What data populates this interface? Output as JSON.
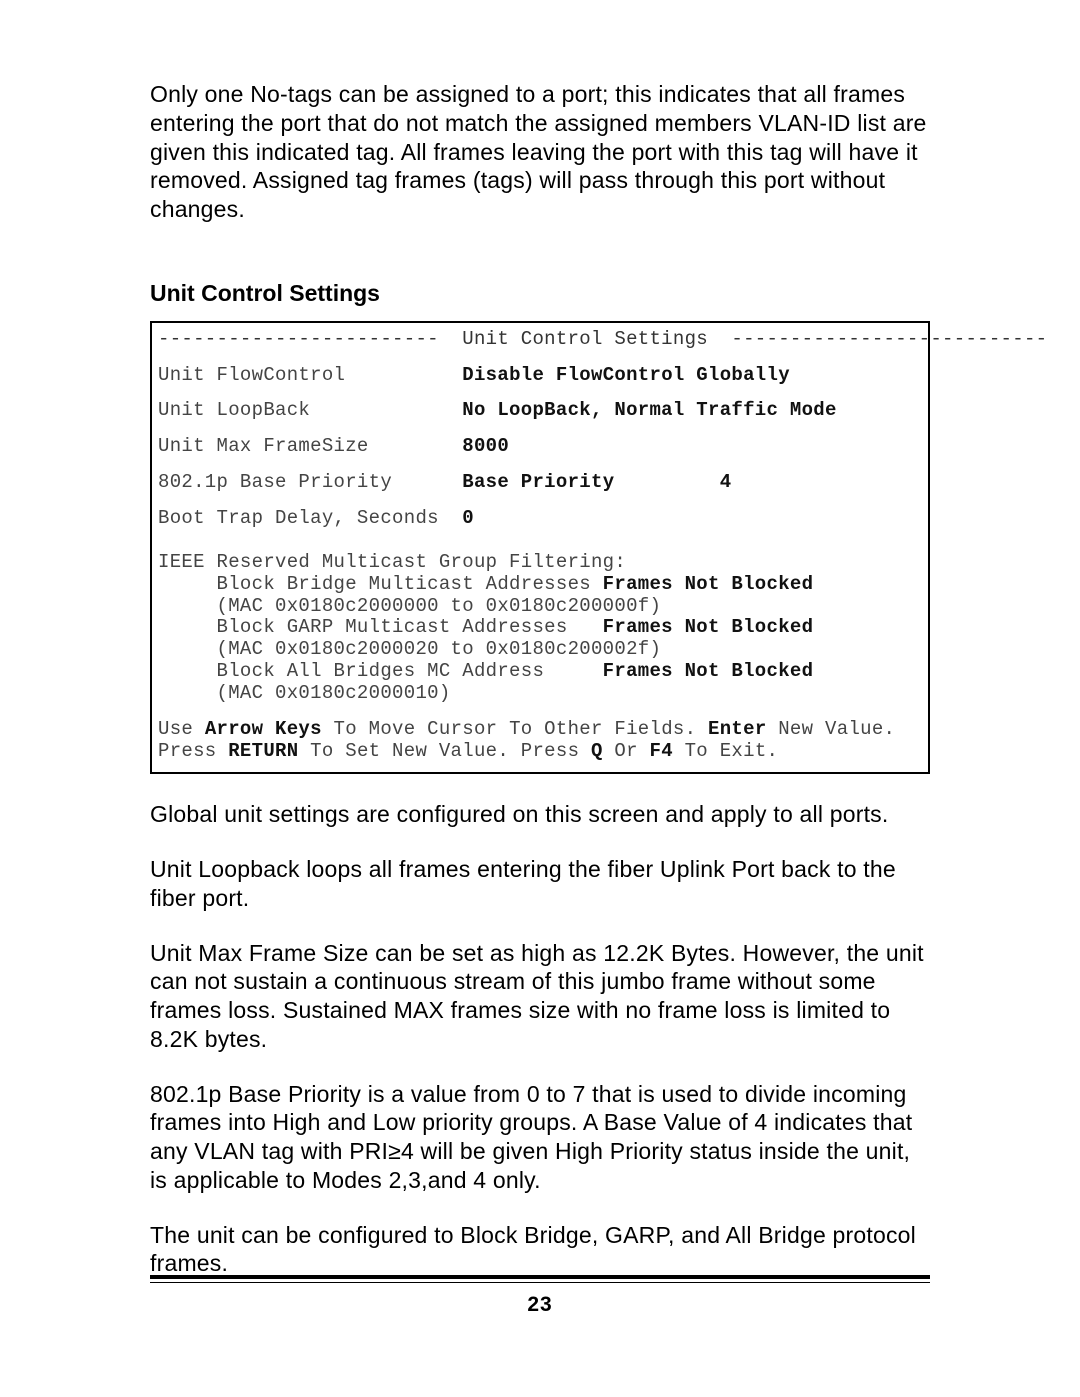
{
  "paragraphs": {
    "intro": "Only one No-tags can be assigned to a port; this indicates that all frames entering the port that do not match the assigned members VLAN-ID list are given this indicated tag.  All frames leaving the port with this tag will have it removed.  Assigned tag frames (tags) will pass through this port without changes.",
    "p1": "Global unit settings are configured on this screen and apply to all ports.",
    "p2": "Unit Loopback loops all frames entering the fiber Uplink Port back to the fiber port.",
    "p3": "Unit Max Frame Size can be set as high as 12.2K Bytes.  However, the unit can not sustain a continuous stream of this jumbo frame without some frames loss.  Sustained MAX frames size with no frame loss is limited to 8.2K bytes.",
    "p4": "802.1p Base Priority is a value from 0 to 7 that is used to divide incoming frames into High and Low priority groups.  A Base Value of 4 indicates that any VLAN tag with PRI≥4 will be given High Priority status inside the unit, is applicable to Modes 2,3,and 4 only.",
    "p5": "The unit can be configured to Block Bridge, GARP, and All Bridge protocol frames."
  },
  "section_title": "Unit Control Settings",
  "terminal": {
    "header_left": "------------------------  ",
    "header_title": "Unit Control Settings",
    "header_right": "  ---------------------------",
    "flow_label": "Unit FlowControl",
    "flow_value": "Disable FlowControl Globally",
    "loop_label": "Unit LoopBack",
    "loop_value": "No LoopBack, Normal Traffic Mode",
    "max_label": "Unit Max FrameSize",
    "max_value": "8000",
    "prio_label": "802.1p Base Priority",
    "prio_text": "Base Priority",
    "prio_value": "4",
    "trap_label": "Boot Trap Delay, Seconds",
    "trap_value": "0",
    "ieee_header": "IEEE Reserved Multicast Group Filtering:",
    "bb_label": "     Block Bridge Multicast Addresses ",
    "bb_value": "Frames Not Blocked",
    "bb_mac": "     (MAC 0x0180c2000000 to 0x0180c200000f)",
    "bg_label": "     Block GARP Multicast Addresses   ",
    "bg_value": "Frames Not Blocked",
    "bg_mac": "     (MAC 0x0180c2000020 to 0x0180c200002f)",
    "ba_label": "     Block All Bridges MC Address     ",
    "ba_value": "Frames Not Blocked",
    "ba_mac": "     (MAC 0x0180c2000010)",
    "hint1_a": "Use ",
    "hint1_b": "Arrow Keys",
    "hint1_c": " To Move Cursor To Other Fields. ",
    "hint1_d": "Enter",
    "hint1_e": " New Value.",
    "hint2_a": "Press ",
    "hint2_b": "RETURN",
    "hint2_c": " To Set New Value. Press ",
    "hint2_d": "Q",
    "hint2_e": " Or ",
    "hint2_f": "F4",
    "hint2_g": " To Exit."
  },
  "page_number": "23"
}
